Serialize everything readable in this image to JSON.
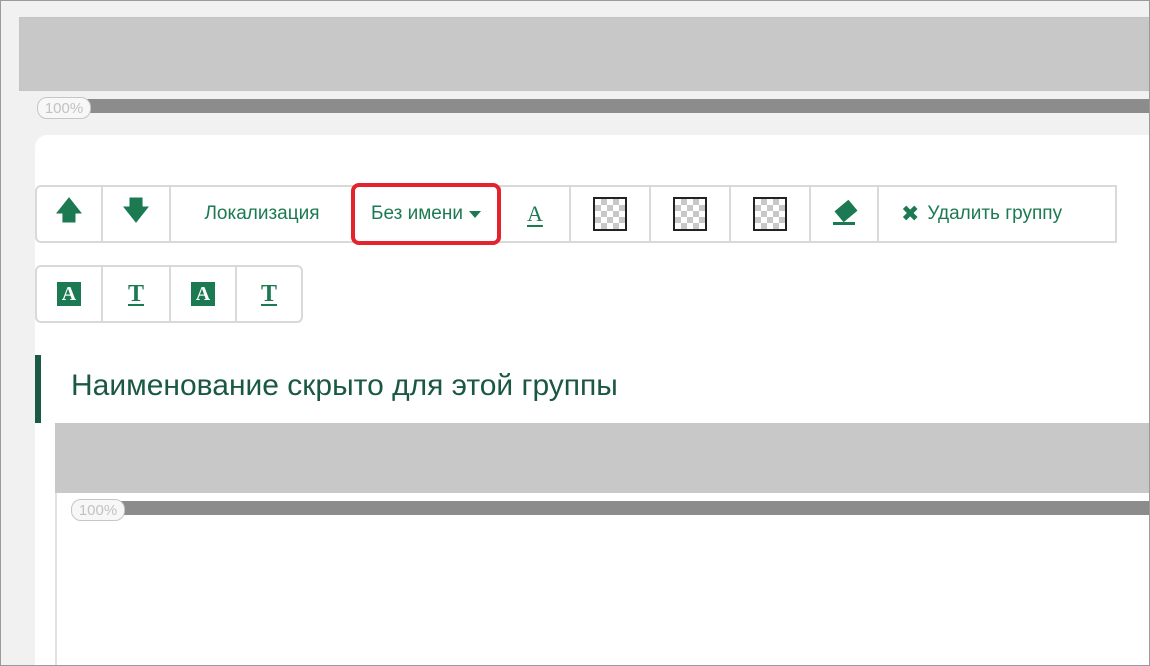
{
  "outer": {
    "zoom_label": "100%"
  },
  "toolbar": {
    "move_up_icon": "arrow-up-icon",
    "move_down_icon": "arrow-down-icon",
    "localization_label": "Локализация",
    "name_dropdown_value": "Без имени",
    "font_color_glyph": "A",
    "delete_group_label": "Удалить группу"
  },
  "toolbar2": {
    "glyphs": [
      "A",
      "T",
      "A",
      "T"
    ]
  },
  "section": {
    "title": "Наименование скрыто для этой группы"
  },
  "inner": {
    "zoom_label": "100%"
  },
  "colors": {
    "accent": "#1c7a52",
    "highlight": "#e3232e",
    "title": "#1b5843"
  }
}
